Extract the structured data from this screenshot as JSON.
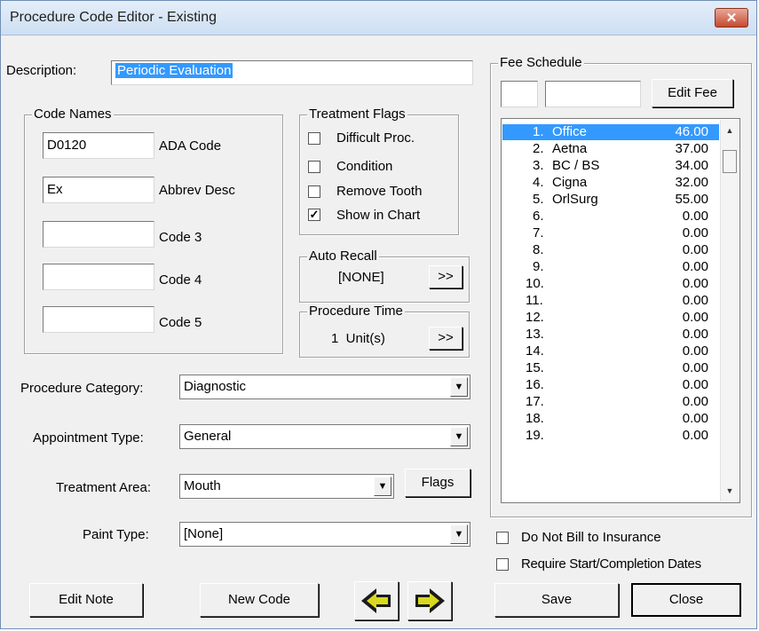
{
  "window": {
    "title": "Procedure Code Editor - Existing",
    "close_glyph": "✕"
  },
  "description": {
    "label": "Description:",
    "value": "Periodic Evaluation"
  },
  "code_names": {
    "legend": "Code Names",
    "ada": {
      "value": "D0120",
      "label": "ADA Code"
    },
    "abbrev": {
      "value": "Ex",
      "label": "Abbrev Desc"
    },
    "code3": {
      "value": "",
      "label": "Code 3"
    },
    "code4": {
      "value": "",
      "label": "Code 4"
    },
    "code5": {
      "value": "",
      "label": "Code 5"
    }
  },
  "treatment_flags": {
    "legend": "Treatment Flags",
    "difficult": {
      "label": "Difficult Proc.",
      "checked": false
    },
    "condition": {
      "label": "Condition",
      "checked": false
    },
    "remove_tooth": {
      "label": "Remove Tooth",
      "checked": false
    },
    "show_in_chart": {
      "label": "Show in Chart",
      "checked": true
    }
  },
  "auto_recall": {
    "legend": "Auto Recall",
    "value": "[NONE]",
    "button": ">>"
  },
  "procedure_time": {
    "legend": "Procedure Time",
    "value": "1  Unit(s)",
    "button": ">>"
  },
  "procedure_category": {
    "label": "Procedure Category:",
    "value": "Diagnostic"
  },
  "appointment_type": {
    "label": "Appointment Type:",
    "value": "General"
  },
  "treatment_area": {
    "label": "Treatment Area:",
    "value": "Mouth",
    "flags_button": "Flags"
  },
  "paint_type": {
    "label": "Paint Type:",
    "value": "[None]"
  },
  "fee_schedule": {
    "legend": "Fee Schedule",
    "field1": "",
    "field2": "",
    "edit_fee_button": "Edit Fee",
    "rows": [
      {
        "num": "1.",
        "name": "Office",
        "fee": "46.00",
        "selected": true
      },
      {
        "num": "2.",
        "name": "Aetna",
        "fee": "37.00"
      },
      {
        "num": "3.",
        "name": "BC / BS",
        "fee": "34.00"
      },
      {
        "num": "4.",
        "name": "Cigna",
        "fee": "32.00"
      },
      {
        "num": "5.",
        "name": "OrlSurg",
        "fee": "55.00"
      },
      {
        "num": "6.",
        "name": "",
        "fee": "0.00"
      },
      {
        "num": "7.",
        "name": "",
        "fee": "0.00"
      },
      {
        "num": "8.",
        "name": "",
        "fee": "0.00"
      },
      {
        "num": "9.",
        "name": "",
        "fee": "0.00"
      },
      {
        "num": "10.",
        "name": "",
        "fee": "0.00"
      },
      {
        "num": "11.",
        "name": "",
        "fee": "0.00"
      },
      {
        "num": "12.",
        "name": "",
        "fee": "0.00"
      },
      {
        "num": "13.",
        "name": "",
        "fee": "0.00"
      },
      {
        "num": "14.",
        "name": "",
        "fee": "0.00"
      },
      {
        "num": "15.",
        "name": "",
        "fee": "0.00"
      },
      {
        "num": "16.",
        "name": "",
        "fee": "0.00"
      },
      {
        "num": "17.",
        "name": "",
        "fee": "0.00"
      },
      {
        "num": "18.",
        "name": "",
        "fee": "0.00"
      },
      {
        "num": "19.",
        "name": "",
        "fee": "0.00"
      }
    ]
  },
  "do_not_bill": {
    "label": "Do Not Bill to Insurance",
    "checked": false
  },
  "require_dates": {
    "label": "Require Start/Completion Dates",
    "checked": false
  },
  "buttons": {
    "edit_note": "Edit Note",
    "new_code": "New Code",
    "save": "Save",
    "close": "Close"
  },
  "colors": {
    "selection": "#3399ff",
    "dialog_bg": "#f0f0f0",
    "close_button": "#c54a32"
  },
  "icons": {
    "prev": "arrow-left-icon",
    "next": "arrow-right-icon",
    "dropdown": "chevron-down-icon"
  }
}
